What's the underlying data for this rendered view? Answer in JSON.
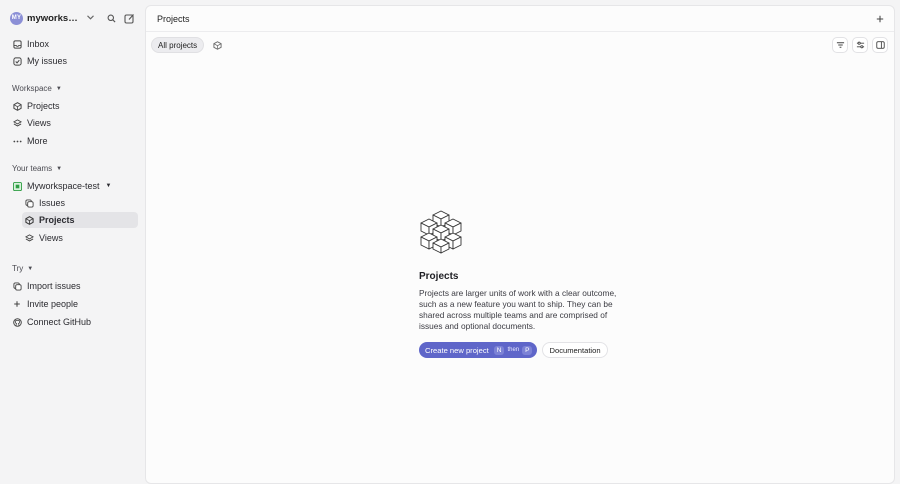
{
  "workspace": {
    "avatar_initials": "MY",
    "name": "myworkspace-test"
  },
  "sidebar": {
    "top_items": [
      {
        "label": "Inbox",
        "icon": "inbox-icon"
      },
      {
        "label": "My issues",
        "icon": "my-issues-icon"
      }
    ],
    "workspace_section": {
      "label": "Workspace",
      "items": [
        {
          "label": "Projects",
          "icon": "projects-icon"
        },
        {
          "label": "Views",
          "icon": "views-icon"
        },
        {
          "label": "More",
          "icon": "more-icon"
        }
      ]
    },
    "teams_section": {
      "label": "Your teams",
      "team": {
        "label": "Myworkspace-test",
        "icon": "team-icon"
      },
      "team_items": [
        {
          "label": "Issues",
          "icon": "issues-icon"
        },
        {
          "label": "Projects",
          "icon": "projects-icon",
          "active": true
        },
        {
          "label": "Views",
          "icon": "views-icon"
        }
      ]
    },
    "try_section": {
      "label": "Try",
      "items": [
        {
          "label": "Import issues",
          "icon": "import-icon"
        },
        {
          "label": "Invite people",
          "icon": "plus-icon"
        },
        {
          "label": "Connect GitHub",
          "icon": "github-icon"
        }
      ]
    }
  },
  "main": {
    "title": "Projects",
    "tabs": [
      {
        "label": "All projects"
      }
    ],
    "empty_state": {
      "title": "Projects",
      "description": "Projects are larger units of work with a clear outcome, such as a new feature you want to ship. They can be shared across multiple teams and are comprised of issues and optional documents.",
      "primary_button": {
        "label": "Create new project",
        "shortcut_key1": "N",
        "shortcut_then": "then",
        "shortcut_key2": "P"
      },
      "secondary_button": {
        "label": "Documentation"
      }
    }
  },
  "colors": {
    "accent": "#5f66c9",
    "avatar": "#8b8fd6",
    "sidebar_bg": "#f4f4f5",
    "active_item": "#e4e4e7"
  }
}
